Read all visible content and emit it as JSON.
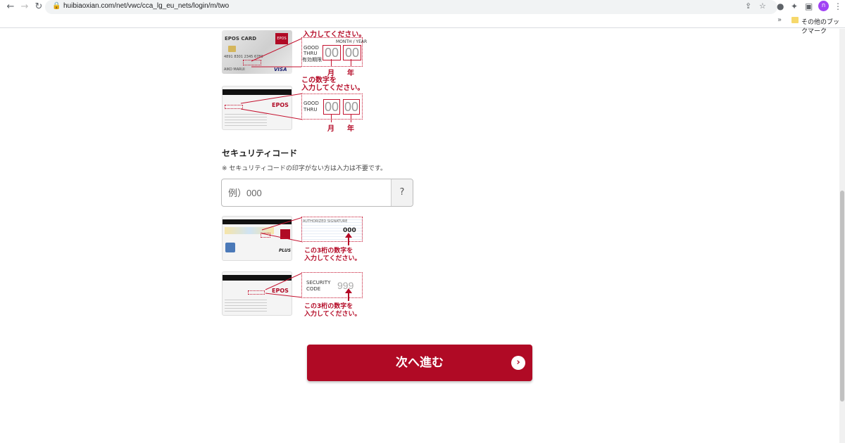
{
  "browser": {
    "url": "huibiaoxian.com/net/vwc/cca_lg_eu_nets/login/m/two",
    "bookmark_label": "その他のブックマーク",
    "profile_initial": "ก"
  },
  "expiry_front": {
    "instruction": "入力してください。",
    "card_brand": "EPOS CARD",
    "card_logo": "EPOS",
    "card_number": "4891 8301 2345 6789",
    "card_holder": "AIKO MARUI",
    "card_network": "VISA",
    "month_year_label": "MONTH / YEAR",
    "good_thru": "GOOD THRU",
    "expiry_label": "有効期限",
    "month_value": "00",
    "year_value": "00",
    "month_char": "月",
    "year_char": "年"
  },
  "expiry_back": {
    "instruction_line1": "この数字を",
    "instruction_line2": "入力してください。",
    "card_logo": "EPOS",
    "good_thru": "GOOD THRU",
    "month_value": "00",
    "year_value": "00",
    "month_char": "月",
    "year_char": "年"
  },
  "security_code": {
    "title": "セキュリティコード",
    "note": "※ セキュリティコードの印字がない方は入力は不要です。",
    "placeholder": "例）000",
    "help_label": "?"
  },
  "cvv_back_example": {
    "signature_label": "AUTHORIZED SIGNATURE",
    "code_value": "000",
    "instruction_line1": "この3桁の数字を",
    "instruction_line2": "入力してください。"
  },
  "cvv_front_example": {
    "card_logo": "EPOS",
    "security_label": "SECURITY CODE",
    "code_value": "999",
    "instruction_line1": "この3桁の数字を",
    "instruction_line2": "入力してください。"
  },
  "submit_label": "次へ進む",
  "colors": {
    "accent": "#b00a25",
    "callout_border": "#c4122f"
  }
}
